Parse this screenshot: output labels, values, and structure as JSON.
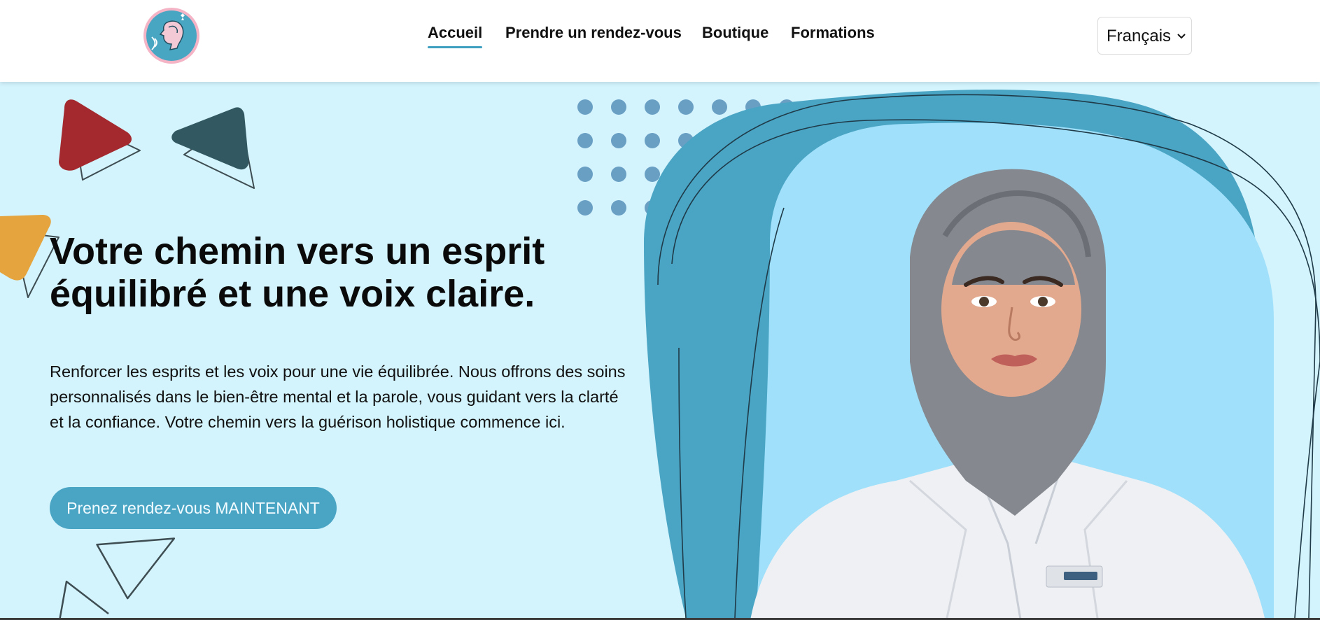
{
  "nav": {
    "items": [
      {
        "label": "Accueil",
        "active": true
      },
      {
        "label": "Prendre un rendez-vous",
        "active": false
      },
      {
        "label": "Boutique",
        "active": false
      },
      {
        "label": "Formations",
        "active": false
      }
    ]
  },
  "language": {
    "selected": "Français"
  },
  "hero": {
    "title_line1": "Votre chemin vers un esprit",
    "title_line2": "équilibré et une voix claire.",
    "description": "Renforcer les esprits et les voix pour une vie équilibrée. Nous offrons des soins personnalisés dans le bien-être mental et la parole, vous guidant vers la clarté et la confiance. Votre chemin vers la guérison holistique commence ici.",
    "cta_label": "Prenez rendez-vous MAINTENANT"
  },
  "colors": {
    "accent": "#4aa5c4",
    "hero_bg": "#d3f3fd",
    "triangle_red": "#a4292e",
    "triangle_teal": "#325962",
    "triangle_yellow": "#e5a43d",
    "dots": "#6a9fc4",
    "blob_dark": "#4aa5c4",
    "blob_light": "#a0e0fa"
  },
  "icons": {
    "logo": "head-profile-logo",
    "language_chevron": "chevron-down-icon"
  }
}
